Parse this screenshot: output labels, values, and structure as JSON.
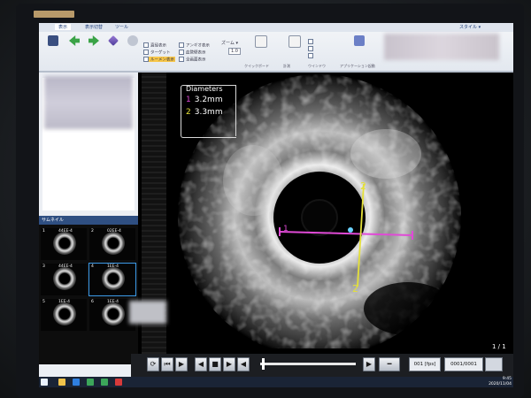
{
  "ribbon": {
    "tabs": [
      {
        "label": "表示"
      },
      {
        "label": "表示切替"
      },
      {
        "label": "ツール"
      }
    ],
    "style_label": "スタイル ▾",
    "checkboxes": [
      "直径表示",
      "ターゲット",
      "ルーメン表示",
      "アンギオ表示",
      "血管壁表示",
      "全画面表示"
    ],
    "zoom_label": "ズーム ▾",
    "zoom_value": "1.0",
    "group_labels": [
      "クイックボード",
      "計測",
      "ウインドウ",
      "アプリケーション起動"
    ]
  },
  "thumbnails": {
    "header": "サムネイル",
    "items": [
      {
        "num": "1",
        "label": "44EE-4"
      },
      {
        "num": "2",
        "label": "02EE-4"
      },
      {
        "num": "3",
        "label": "44EE-4"
      },
      {
        "num": "4",
        "label": "1EE-4"
      },
      {
        "num": "5",
        "label": "1EE-4"
      },
      {
        "num": "6",
        "label": "1EE-4"
      }
    ]
  },
  "measurements": {
    "title": "Diameters",
    "items": [
      {
        "index": "1",
        "value": "3.2mm",
        "color": "#e04ad6"
      },
      {
        "index": "2",
        "value": "3.3mm",
        "color": "#e4e038"
      }
    ]
  },
  "overlay": {
    "line1_marker": "1",
    "line2_marker_top": "2",
    "line2_marker_bottom": "2"
  },
  "page_indicator": "1 / 1",
  "player": {
    "frame_number": "001 [fps]",
    "frame_total": "0001/0001",
    "slider_position": 0.02
  },
  "taskbar": {
    "time": "9:45",
    "date": "2020/11/04"
  }
}
